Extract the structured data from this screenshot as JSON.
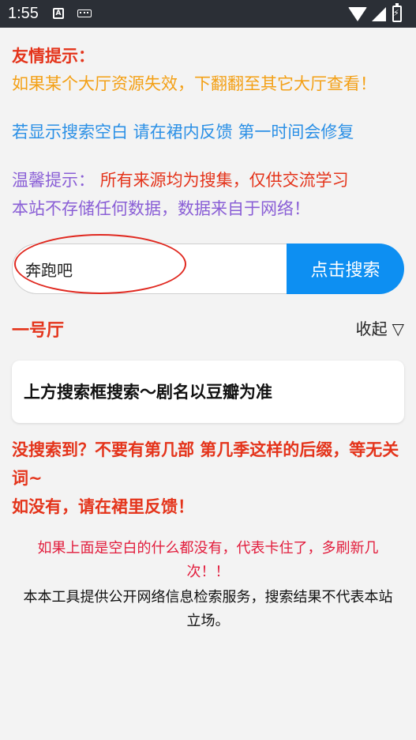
{
  "status_bar": {
    "time": "1:55",
    "notification_icons": [
      "a-icon",
      "keyboard-icon"
    ],
    "right_icons": [
      "wifi-icon",
      "signal-icon",
      "battery-charging-icon"
    ]
  },
  "tips": {
    "friendly_title": "友情提示：",
    "friendly_body": "如果某个大厅资源失效，下翻翻至其它大厅查看！",
    "search_blank": "若显示搜索空白 请在裙内反馈 第一时间会修复",
    "warm_label": "温馨提示：",
    "warm_body_1": "所有来源均为搜集，仅供交流学习",
    "warm_body_2": "本站不存储任何数据，数据来自于网络！"
  },
  "search": {
    "value": "奔跑吧",
    "button_label": "点击搜索"
  },
  "hall": {
    "title": "一号厅",
    "collapse_label": "收起",
    "collapse_symbol": "▽",
    "card_text": "上方搜索框搜索～剧名以豆瓣为准"
  },
  "not_found": {
    "line1": "没搜索到？不要有第几部 第几季这样的后缀，等无关词~",
    "line2": "如没有，请在裙里反馈！"
  },
  "footer": {
    "refresh_tip": "如果上面是空白的什么都没有，代表卡住了，多刷新几次！！",
    "disclaimer": "本本工具提供公开网络信息检索服务，搜索结果不代表本站立场。"
  },
  "colors": {
    "red": "#e4341b",
    "orange": "#f3a016",
    "blue": "#2b90e6",
    "purple": "#8a5fd6",
    "button": "#0d8ff2"
  }
}
